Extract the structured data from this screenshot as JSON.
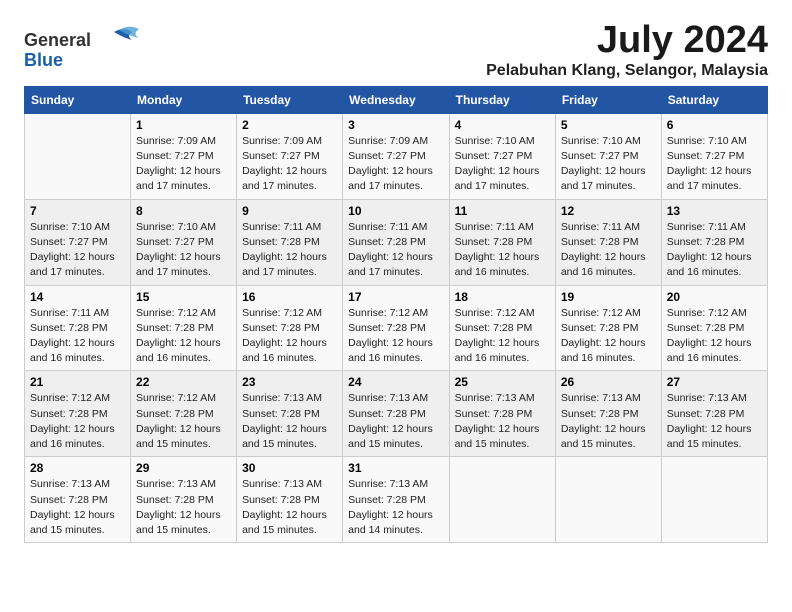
{
  "header": {
    "logo_general": "General",
    "logo_blue": "Blue",
    "title": "July 2024",
    "subtitle": "Pelabuhan Klang, Selangor, Malaysia"
  },
  "weekdays": [
    "Sunday",
    "Monday",
    "Tuesday",
    "Wednesday",
    "Thursday",
    "Friday",
    "Saturday"
  ],
  "weeks": [
    [
      {
        "day": "",
        "info": ""
      },
      {
        "day": "1",
        "info": "Sunrise: 7:09 AM\nSunset: 7:27 PM\nDaylight: 12 hours and 17 minutes."
      },
      {
        "day": "2",
        "info": "Sunrise: 7:09 AM\nSunset: 7:27 PM\nDaylight: 12 hours and 17 minutes."
      },
      {
        "day": "3",
        "info": "Sunrise: 7:09 AM\nSunset: 7:27 PM\nDaylight: 12 hours and 17 minutes."
      },
      {
        "day": "4",
        "info": "Sunrise: 7:10 AM\nSunset: 7:27 PM\nDaylight: 12 hours and 17 minutes."
      },
      {
        "day": "5",
        "info": "Sunrise: 7:10 AM\nSunset: 7:27 PM\nDaylight: 12 hours and 17 minutes."
      },
      {
        "day": "6",
        "info": "Sunrise: 7:10 AM\nSunset: 7:27 PM\nDaylight: 12 hours and 17 minutes."
      }
    ],
    [
      {
        "day": "7",
        "info": "Sunrise: 7:10 AM\nSunset: 7:27 PM\nDaylight: 12 hours and 17 minutes."
      },
      {
        "day": "8",
        "info": "Sunrise: 7:10 AM\nSunset: 7:27 PM\nDaylight: 12 hours and 17 minutes."
      },
      {
        "day": "9",
        "info": "Sunrise: 7:11 AM\nSunset: 7:28 PM\nDaylight: 12 hours and 17 minutes."
      },
      {
        "day": "10",
        "info": "Sunrise: 7:11 AM\nSunset: 7:28 PM\nDaylight: 12 hours and 17 minutes."
      },
      {
        "day": "11",
        "info": "Sunrise: 7:11 AM\nSunset: 7:28 PM\nDaylight: 12 hours and 16 minutes."
      },
      {
        "day": "12",
        "info": "Sunrise: 7:11 AM\nSunset: 7:28 PM\nDaylight: 12 hours and 16 minutes."
      },
      {
        "day": "13",
        "info": "Sunrise: 7:11 AM\nSunset: 7:28 PM\nDaylight: 12 hours and 16 minutes."
      }
    ],
    [
      {
        "day": "14",
        "info": "Sunrise: 7:11 AM\nSunset: 7:28 PM\nDaylight: 12 hours and 16 minutes."
      },
      {
        "day": "15",
        "info": "Sunrise: 7:12 AM\nSunset: 7:28 PM\nDaylight: 12 hours and 16 minutes."
      },
      {
        "day": "16",
        "info": "Sunrise: 7:12 AM\nSunset: 7:28 PM\nDaylight: 12 hours and 16 minutes."
      },
      {
        "day": "17",
        "info": "Sunrise: 7:12 AM\nSunset: 7:28 PM\nDaylight: 12 hours and 16 minutes."
      },
      {
        "day": "18",
        "info": "Sunrise: 7:12 AM\nSunset: 7:28 PM\nDaylight: 12 hours and 16 minutes."
      },
      {
        "day": "19",
        "info": "Sunrise: 7:12 AM\nSunset: 7:28 PM\nDaylight: 12 hours and 16 minutes."
      },
      {
        "day": "20",
        "info": "Sunrise: 7:12 AM\nSunset: 7:28 PM\nDaylight: 12 hours and 16 minutes."
      }
    ],
    [
      {
        "day": "21",
        "info": "Sunrise: 7:12 AM\nSunset: 7:28 PM\nDaylight: 12 hours and 16 minutes."
      },
      {
        "day": "22",
        "info": "Sunrise: 7:12 AM\nSunset: 7:28 PM\nDaylight: 12 hours and 15 minutes."
      },
      {
        "day": "23",
        "info": "Sunrise: 7:13 AM\nSunset: 7:28 PM\nDaylight: 12 hours and 15 minutes."
      },
      {
        "day": "24",
        "info": "Sunrise: 7:13 AM\nSunset: 7:28 PM\nDaylight: 12 hours and 15 minutes."
      },
      {
        "day": "25",
        "info": "Sunrise: 7:13 AM\nSunset: 7:28 PM\nDaylight: 12 hours and 15 minutes."
      },
      {
        "day": "26",
        "info": "Sunrise: 7:13 AM\nSunset: 7:28 PM\nDaylight: 12 hours and 15 minutes."
      },
      {
        "day": "27",
        "info": "Sunrise: 7:13 AM\nSunset: 7:28 PM\nDaylight: 12 hours and 15 minutes."
      }
    ],
    [
      {
        "day": "28",
        "info": "Sunrise: 7:13 AM\nSunset: 7:28 PM\nDaylight: 12 hours and 15 minutes."
      },
      {
        "day": "29",
        "info": "Sunrise: 7:13 AM\nSunset: 7:28 PM\nDaylight: 12 hours and 15 minutes."
      },
      {
        "day": "30",
        "info": "Sunrise: 7:13 AM\nSunset: 7:28 PM\nDaylight: 12 hours and 15 minutes."
      },
      {
        "day": "31",
        "info": "Sunrise: 7:13 AM\nSunset: 7:28 PM\nDaylight: 12 hours and 14 minutes."
      },
      {
        "day": "",
        "info": ""
      },
      {
        "day": "",
        "info": ""
      },
      {
        "day": "",
        "info": ""
      }
    ]
  ]
}
